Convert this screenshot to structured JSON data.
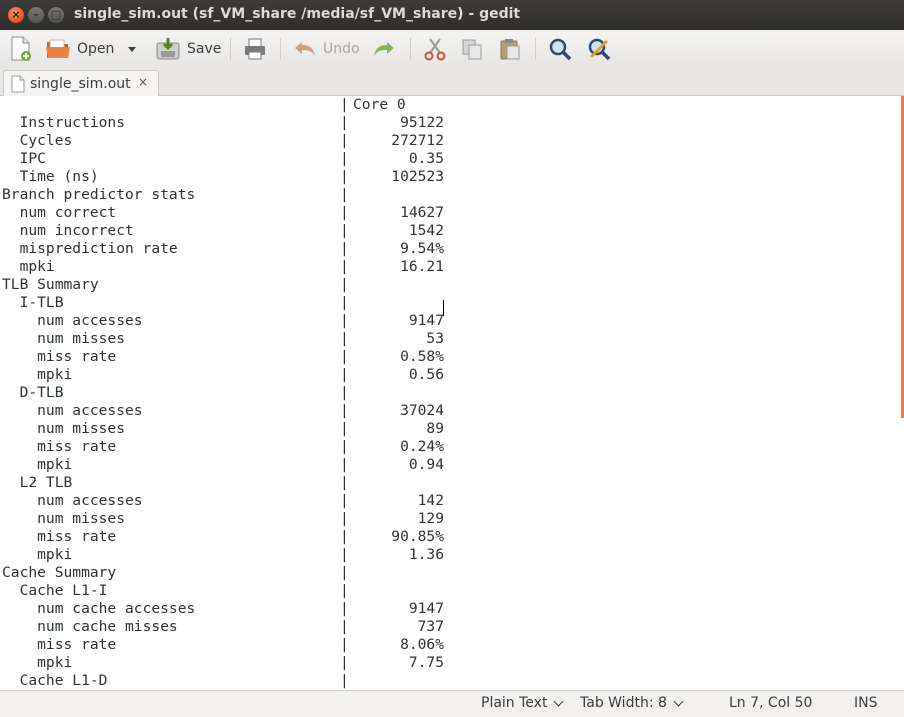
{
  "window": {
    "title": "single_sim.out (sf_VM_share /media/sf_VM_share) - gedit",
    "close_symbol": "×",
    "minimize_symbol": "–",
    "maximize_symbol": "□"
  },
  "toolbar": {
    "open_label": "Open",
    "save_label": "Save",
    "undo_label": "Undo",
    "icons": [
      "new-document-icon",
      "open-folder-icon",
      "dropdown-arrow-icon",
      "save-icon",
      "print-icon",
      "undo-icon",
      "redo-icon",
      "cut-icon",
      "copy-icon",
      "paste-icon",
      "search-icon",
      "replace-icon"
    ]
  },
  "tab": {
    "label": "single_sim.out",
    "close_symbol": "×"
  },
  "editor": {
    "lines": [
      {
        "label": "",
        "value": "Core 0",
        "header": true
      },
      {
        "label": "  Instructions",
        "value": "95122"
      },
      {
        "label": "  Cycles",
        "value": "272712"
      },
      {
        "label": "  IPC",
        "value": "0.35"
      },
      {
        "label": "  Time (ns)",
        "value": "102523"
      },
      {
        "label": "Branch predictor stats",
        "value": ""
      },
      {
        "label": "  num correct",
        "value": "14627"
      },
      {
        "label": "  num incorrect",
        "value": "1542"
      },
      {
        "label": "  misprediction rate",
        "value": "9.54%"
      },
      {
        "label": "  mpki",
        "value": "16.21"
      },
      {
        "label": "TLB Summary",
        "value": ""
      },
      {
        "label": "  I-TLB",
        "value": ""
      },
      {
        "label": "    num accesses",
        "value": "9147"
      },
      {
        "label": "    num misses",
        "value": "53"
      },
      {
        "label": "    miss rate",
        "value": "0.58%"
      },
      {
        "label": "    mpki",
        "value": "0.56"
      },
      {
        "label": "  D-TLB",
        "value": ""
      },
      {
        "label": "    num accesses",
        "value": "37024"
      },
      {
        "label": "    num misses",
        "value": "89"
      },
      {
        "label": "    miss rate",
        "value": "0.24%"
      },
      {
        "label": "    mpki",
        "value": "0.94"
      },
      {
        "label": "  L2 TLB",
        "value": ""
      },
      {
        "label": "    num accesses",
        "value": "142"
      },
      {
        "label": "    num misses",
        "value": "129"
      },
      {
        "label": "    miss rate",
        "value": "90.85%"
      },
      {
        "label": "    mpki",
        "value": "1.36"
      },
      {
        "label": "Cache Summary",
        "value": ""
      },
      {
        "label": "  Cache L1-I",
        "value": ""
      },
      {
        "label": "    num cache accesses",
        "value": "9147"
      },
      {
        "label": "    num cache misses",
        "value": "737"
      },
      {
        "label": "    miss rate",
        "value": "8.06%"
      },
      {
        "label": "    mpki",
        "value": "7.75"
      },
      {
        "label": "  Cache L1-D",
        "value": ""
      }
    ]
  },
  "statusbar": {
    "language": "Plain Text",
    "tab_width": "Tab Width: 8",
    "cursor": "Ln 7, Col 50",
    "mode": "INS"
  },
  "colors": {
    "titlebar": "#3c3b37",
    "close_button": "#e95420",
    "scrollbar_accent": "#f07746",
    "editor_bg": "#ffffff"
  }
}
